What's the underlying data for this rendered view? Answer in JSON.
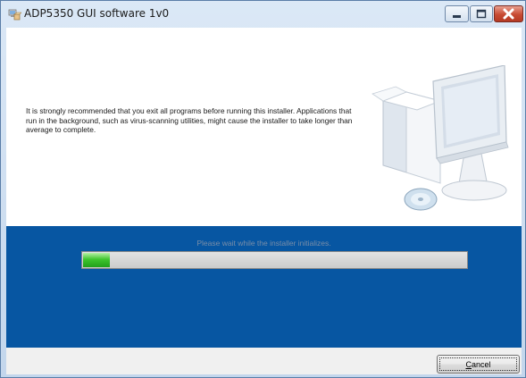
{
  "window": {
    "title": "ADP5350 GUI software 1v0",
    "controls": [
      "minimize",
      "maximize",
      "close"
    ]
  },
  "message": {
    "text": "It is strongly recommended that you exit all programs before running this installer. Applications that run in the background, such as virus-scanning utilities, might cause the installer to take longer than average to complete."
  },
  "progress": {
    "status": "Please wait while the installer initializes.",
    "value": 0.07
  },
  "footer": {
    "cancel_accel": "C",
    "cancel_rest": "ancel"
  },
  "colors": {
    "panel": "#0756a2",
    "progress_fill": "#3fc52e",
    "close_button": "#c74a33"
  },
  "icons": [
    "installer-app-icon",
    "minimize-icon",
    "maximize-icon",
    "close-icon",
    "computer-install-illustration"
  ]
}
